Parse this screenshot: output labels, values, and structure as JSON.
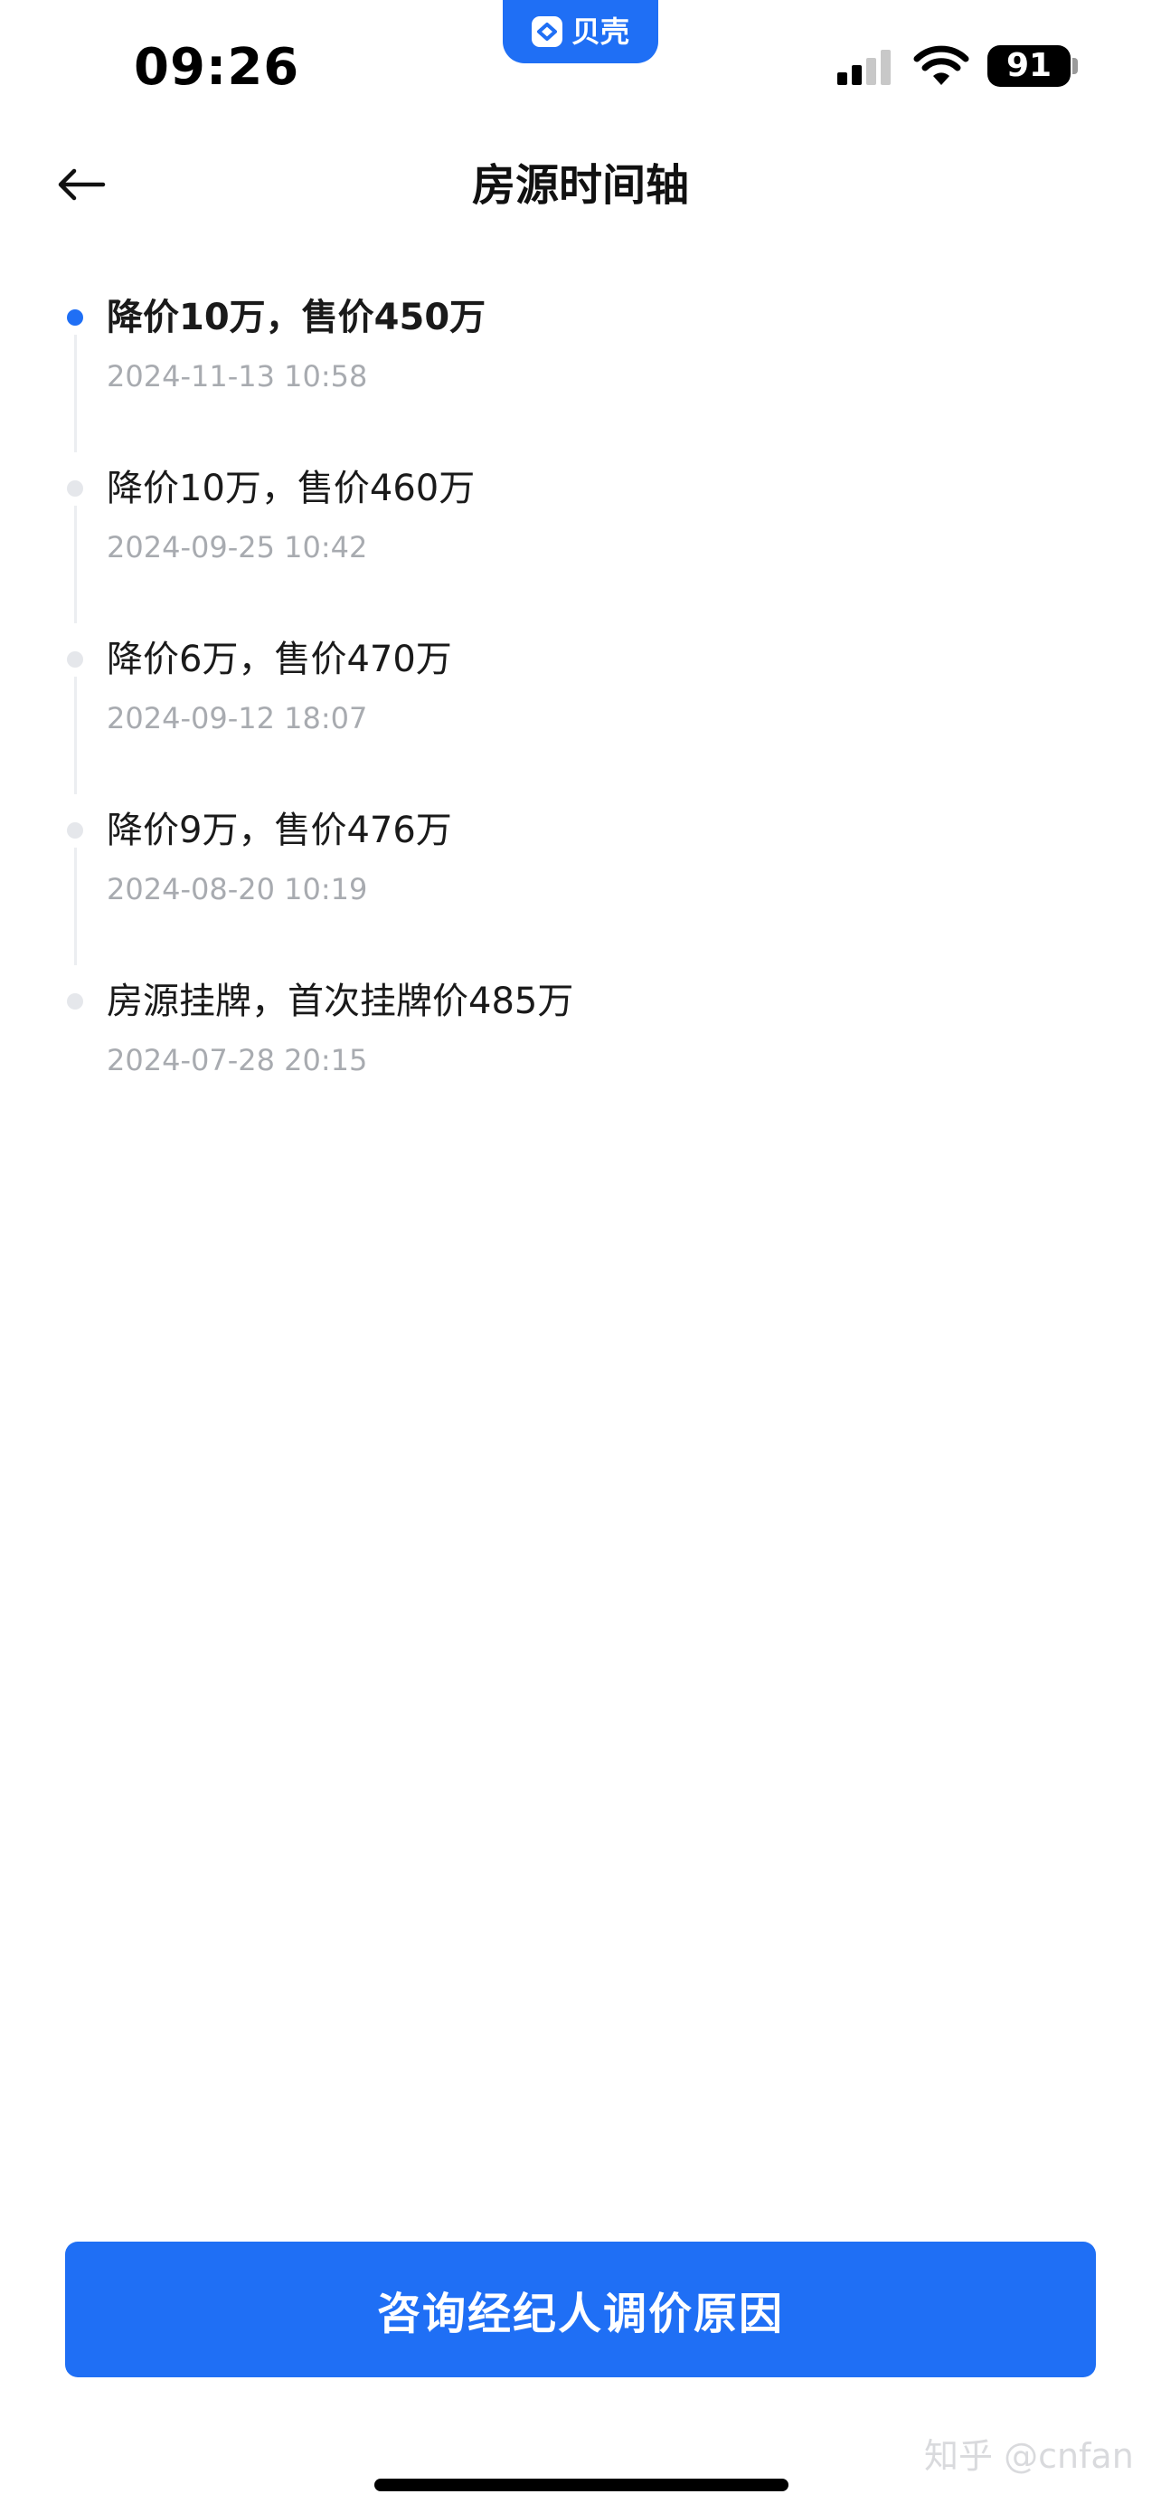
{
  "status_bar": {
    "time": "09:26",
    "app_badge_label": "贝壳",
    "battery_level": "91",
    "signal_icon": "signal-icon",
    "wifi_icon": "wifi-icon"
  },
  "nav": {
    "back_icon": "arrow-left-icon",
    "title": "房源时间轴"
  },
  "timeline": [
    {
      "title": "降价10万，售价450万",
      "time": "2024-11-13 10:58",
      "active": true
    },
    {
      "title": "降价10万，售价460万",
      "time": "2024-09-25 10:42",
      "active": false
    },
    {
      "title": "降价6万，售价470万",
      "time": "2024-09-12 18:07",
      "active": false
    },
    {
      "title": "降价9万，售价476万",
      "time": "2024-08-20 10:19",
      "active": false
    },
    {
      "title": "房源挂牌，首次挂牌价485万",
      "time": "2024-07-28 20:15",
      "active": false
    }
  ],
  "cta": {
    "label": "咨询经纪人调价原因"
  },
  "watermark": "知乎 @cnfan",
  "colors": {
    "accent": "#1f6ff5",
    "inactive_dot": "#e5e7eb",
    "timestamp": "#a8abb0",
    "line": "#eceef1"
  }
}
